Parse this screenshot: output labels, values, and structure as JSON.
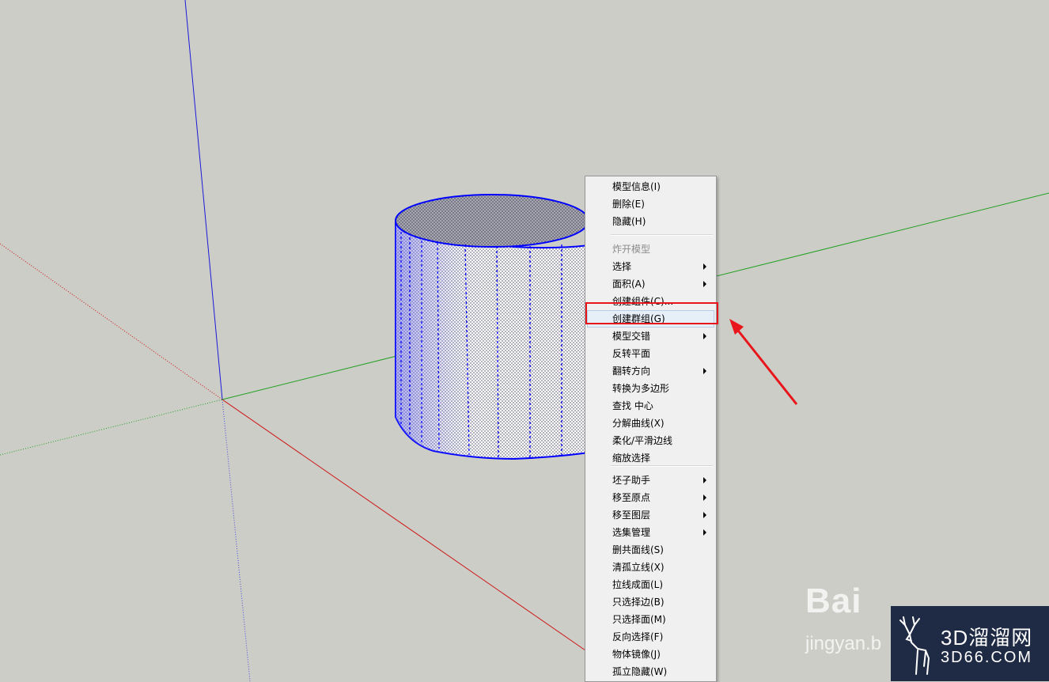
{
  "context_menu": {
    "items": [
      {
        "label": "模型信息(I)",
        "submenu": false,
        "enabled": true
      },
      {
        "label": "删除(E)",
        "submenu": false,
        "enabled": true
      },
      {
        "label": "隐藏(H)",
        "submenu": false,
        "enabled": true
      },
      {
        "label": "炸开模型",
        "submenu": false,
        "enabled": false
      },
      {
        "label": "选择",
        "submenu": true,
        "enabled": true
      },
      {
        "label": "面积(A)",
        "submenu": true,
        "enabled": true
      },
      {
        "label": "创建组件(C)...",
        "submenu": false,
        "enabled": true
      },
      {
        "label": "创建群组(G)",
        "submenu": false,
        "enabled": true,
        "highlighted": true
      },
      {
        "label": "模型交错",
        "submenu": true,
        "enabled": true
      },
      {
        "label": "反转平面",
        "submenu": false,
        "enabled": true
      },
      {
        "label": "翻转方向",
        "submenu": true,
        "enabled": true
      },
      {
        "label": "转换为多边形",
        "submenu": false,
        "enabled": true
      },
      {
        "label": "查找 中心",
        "submenu": false,
        "enabled": true
      },
      {
        "label": "分解曲线(X)",
        "submenu": false,
        "enabled": true
      },
      {
        "label": "柔化/平滑边线",
        "submenu": false,
        "enabled": true
      },
      {
        "label": "缩放选择",
        "submenu": false,
        "enabled": true
      },
      {
        "label": "坯子助手",
        "submenu": true,
        "enabled": true
      },
      {
        "label": "移至原点",
        "submenu": true,
        "enabled": true
      },
      {
        "label": "移至图层",
        "submenu": true,
        "enabled": true
      },
      {
        "label": "选集管理",
        "submenu": true,
        "enabled": true
      },
      {
        "label": "删共面线(S)",
        "submenu": false,
        "enabled": true
      },
      {
        "label": "清孤立线(X)",
        "submenu": false,
        "enabled": true
      },
      {
        "label": "拉线成面(L)",
        "submenu": false,
        "enabled": true
      },
      {
        "label": "只选择边(B)",
        "submenu": false,
        "enabled": true
      },
      {
        "label": "只选择面(M)",
        "submenu": false,
        "enabled": true
      },
      {
        "label": "反向选择(F)",
        "submenu": false,
        "enabled": true
      },
      {
        "label": "物体镜像(J)",
        "submenu": false,
        "enabled": true
      },
      {
        "label": "孤立隐藏(W)",
        "submenu": false,
        "enabled": true
      }
    ]
  },
  "watermarks": {
    "baidu": "Bai",
    "baidu_sub": "jingyan.b",
    "site_title": "3D溜溜网",
    "site_url": "3D66.COM"
  },
  "colors": {
    "background": "#cdcdc8",
    "axis_blue": "#1a1ad8",
    "axis_red": "#cc1414",
    "axis_green": "#22a022",
    "selection_blue": "#0000ff",
    "annotation_red": "#e8161b",
    "logo_bg": "#1f2a45"
  }
}
